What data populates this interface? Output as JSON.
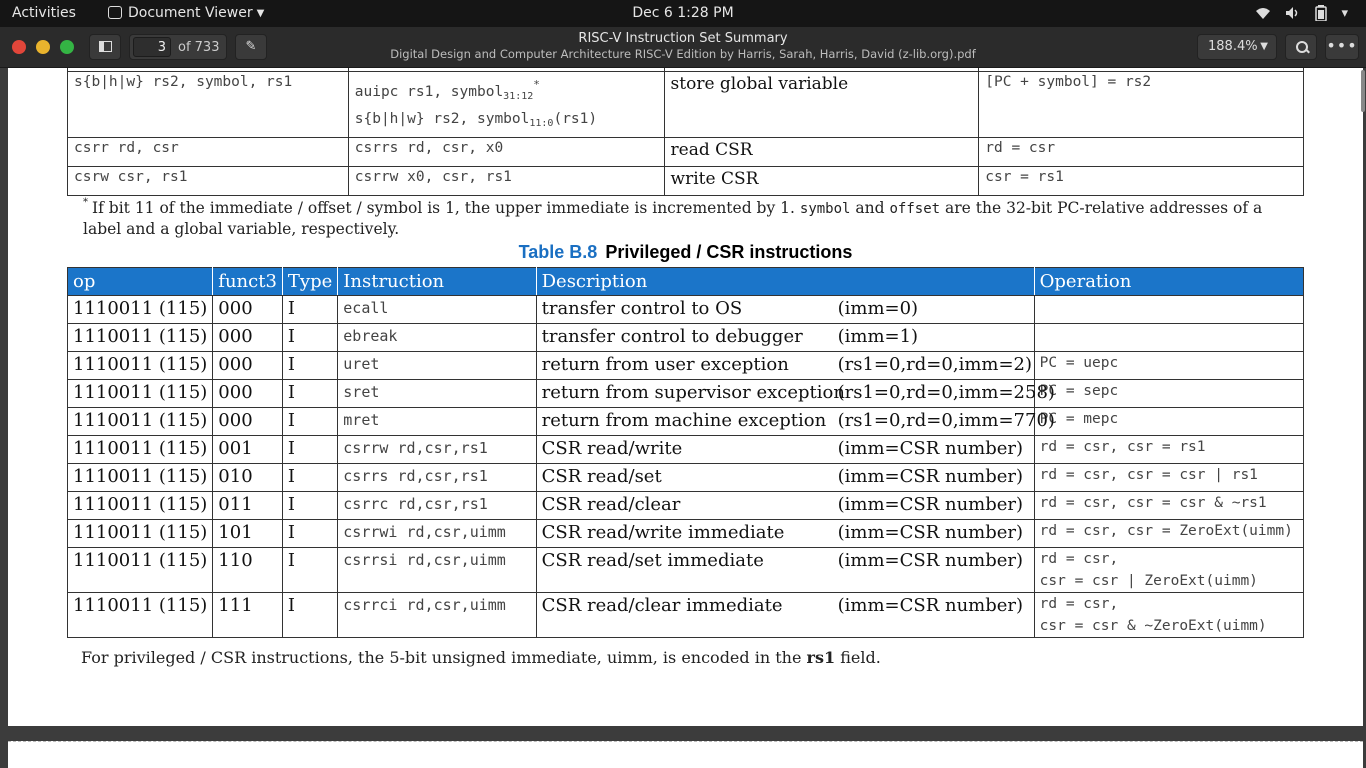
{
  "topbar": {
    "activities": "Activities",
    "app_name": "Document Viewer",
    "clock": "Dec 6   1:28 PM"
  },
  "window": {
    "title": "RISC-V Instruction Set Summary",
    "subtitle": "Digital Design and Computer Architecture RISC-V Edition by Harris, Sarah, Harris, David (z-lib.org).pdf",
    "page_current": "3",
    "page_total": "of 733",
    "zoom": "188.4%",
    "colors": {
      "close": "#e2463a",
      "minimize": "#e9b32d",
      "maximize": "#34b444",
      "accent_blue": "#1b75c9"
    }
  },
  "top_table": {
    "rows": [
      {
        "c1": "s{b|h|w} rs2, symbol, rs1",
        "c2a": "auipc     rs1, symbol",
        "c2a_sub": "31:12",
        "c2b": "s{b|h|w} rs2, symbol",
        "c2b_sub": "11:0",
        "c2b_tail": "(rs1)",
        "c3": "store global variable",
        "c4": "[PC + symbol] = rs2"
      },
      {
        "c1": "csrr rd,  csr",
        "c2a": "csrrs rd,  csr, x0",
        "c3": "read  CSR",
        "c4": "rd = csr"
      },
      {
        "c1": "csrw csr, rs1",
        "c2a": "csrrw x0,  csr, rs1",
        "c3": "write CSR",
        "c4": "csr = rs1"
      }
    ],
    "footnote_pre": "If bit 11 of the immediate / offset / symbol is 1, the upper immediate is incremented by 1.",
    "footnote_symbol": "symbol",
    "footnote_and": "and",
    "footnote_offset": "offset",
    "footnote_post": "are the 32-bit PC-relative addresses of a label and a global variable, respectively."
  },
  "priv_table": {
    "caption_num": "Table B.8",
    "caption_title": "Privileged / CSR instructions",
    "headers": [
      "op",
      "funct3",
      "Type",
      "Instruction",
      "Description",
      "Operation"
    ],
    "rows": [
      {
        "op": "1110011 (115)",
        "funct3": "000",
        "type": "I",
        "instr": "ecall",
        "desc": "transfer control to OS",
        "imm": "(imm=0)",
        "oper": ""
      },
      {
        "op": "1110011 (115)",
        "funct3": "000",
        "type": "I",
        "instr": "ebreak",
        "desc": "transfer control to debugger",
        "imm": "(imm=1)",
        "oper": ""
      },
      {
        "op": "1110011 (115)",
        "funct3": "000",
        "type": "I",
        "instr": "uret",
        "desc": "return from user exception",
        "imm": "(rs1=0,rd=0,imm=2)",
        "oper": "PC = uepc"
      },
      {
        "op": "1110011 (115)",
        "funct3": "000",
        "type": "I",
        "instr": "sret",
        "desc": "return from supervisor exception",
        "imm": "(rs1=0,rd=0,imm=258)",
        "oper": "PC = sepc"
      },
      {
        "op": "1110011 (115)",
        "funct3": "000",
        "type": "I",
        "instr": "mret",
        "desc": "return from machine exception",
        "imm": "(rs1=0,rd=0,imm=770)",
        "oper": "PC = mepc"
      },
      {
        "op": "1110011 (115)",
        "funct3": "001",
        "type": "I",
        "instr": "csrrw  rd,csr,rs1",
        "desc": "CSR read/write",
        "imm": "(imm=CSR number)",
        "oper": "rd = csr, csr = rs1"
      },
      {
        "op": "1110011 (115)",
        "funct3": "010",
        "type": "I",
        "instr": "csrrs  rd,csr,rs1",
        "desc": "CSR read/set",
        "imm": "(imm=CSR number)",
        "oper": "rd = csr, csr = csr |  rs1"
      },
      {
        "op": "1110011 (115)",
        "funct3": "011",
        "type": "I",
        "instr": "csrrc  rd,csr,rs1",
        "desc": "CSR read/clear",
        "imm": "(imm=CSR number)",
        "oper": "rd = csr, csr = csr & ~rs1"
      },
      {
        "op": "1110011 (115)",
        "funct3": "101",
        "type": "I",
        "instr": "csrrwi rd,csr,uimm",
        "desc": "CSR read/write immediate",
        "imm": "(imm=CSR number)",
        "oper": "rd = csr, csr = ZeroExt(uimm)"
      },
      {
        "op": "1110011 (115)",
        "funct3": "110",
        "type": "I",
        "instr": "csrrsi rd,csr,uimm",
        "desc": "CSR read/set immediate",
        "imm": "(imm=CSR number)",
        "oper": "rd = csr,",
        "oper2": "csr = csr |  ZeroExt(uimm)"
      },
      {
        "op": "1110011 (115)",
        "funct3": "111",
        "type": "I",
        "instr": "csrrci rd,csr,uimm",
        "desc": "CSR read/clear immediate",
        "imm": "(imm=CSR number)",
        "oper": "rd = csr,",
        "oper2": "csr = csr & ~ZeroExt(uimm)"
      }
    ],
    "note_pre": "For privileged / CSR instructions,  the 5-bit unsigned immediate, uimm, is encoded in the",
    "note_bold": "rs1",
    "note_post": "field."
  }
}
